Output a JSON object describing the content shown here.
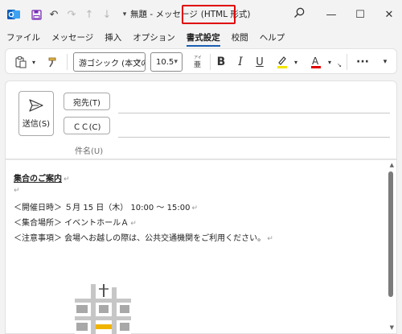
{
  "window": {
    "title": "無題 - メッセージ",
    "format": "(HTML 形式)",
    "highlight_color": "#e00000"
  },
  "menu": {
    "tabs": [
      {
        "label": "ファイル"
      },
      {
        "label": "メッセージ"
      },
      {
        "label": "挿入"
      },
      {
        "label": "オプション"
      },
      {
        "label": "書式設定",
        "active": true
      },
      {
        "label": "校閲"
      },
      {
        "label": "ヘルプ"
      }
    ]
  },
  "ribbon": {
    "font_name": "游ゴシック (本文のフ",
    "font_size": "10.5",
    "accent_underline": "#e00000",
    "highlight_underline": "#f5e400",
    "more_label": "···"
  },
  "header": {
    "send_label": "送信(S)",
    "to_label": "宛先(T)",
    "cc_label": "ＣＣ(C)",
    "subject_label": "件名(U)"
  },
  "body": {
    "heading": "集合のご案内",
    "pilcrow": "↵",
    "lines": [
      "＜開催日時＞ ５月 15 日（木） 10:00 〜 15:00",
      "＜集合場所＞ イベントホールＡ",
      "＜注意事項＞ 会場へお越しの際は、公共交通機関をご利用ください。"
    ]
  },
  "icons": {
    "app": "outlook-icon",
    "save": "save-icon",
    "undo": "undo-icon",
    "redo": "redo-icon"
  }
}
